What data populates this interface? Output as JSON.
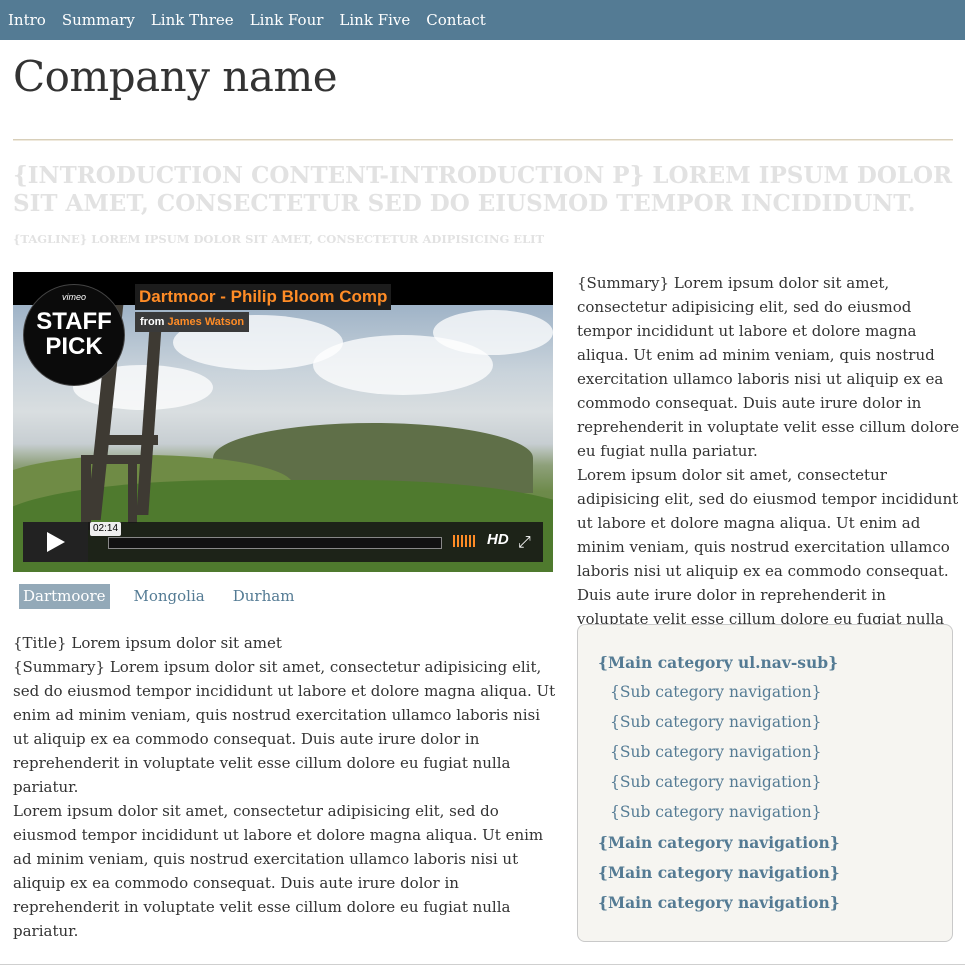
{
  "topnav": {
    "items": [
      "Intro",
      "Summary",
      "Link Three",
      "Link Four",
      "Link Five",
      "Contact"
    ]
  },
  "header": {
    "company_name": "Company name",
    "introduction": "{INTRODUCTION CONTENT-INTRODUCTION P} LOREM IPSUM DOLOR SIT AMET, CONSECTETUR SED DO EIUSMOD TEMPOR INCIDIDUNT.",
    "tagline": "{TAGLINE} LOREM IPSUM DOLOR SIT AMET, CONSECTETUR ADIPISICING ELIT"
  },
  "video": {
    "title": "Dartmoor - Philip Bloom Comp",
    "from_label": "from",
    "author": "James Watson",
    "badge_brand": "vimeo",
    "badge_text_1": "STAFF",
    "badge_text_2": "PICK",
    "time": "02:14",
    "hd_label": "HD",
    "play_icon": "play-icon",
    "fullscreen_icon": "fullscreen-icon",
    "volume_icon": "volume-icon",
    "colors": {
      "accent": "#ff8c26"
    }
  },
  "video_tabs": [
    {
      "label": "Dartmoore",
      "active": true
    },
    {
      "label": "Mongolia",
      "active": false
    },
    {
      "label": "Durham",
      "active": false
    }
  ],
  "left_content": {
    "title": "{Title} Lorem ipsum dolor sit amet",
    "summary": "{Summary} Lorem ipsum dolor sit amet, consectetur adipisicing elit, sed do eiusmod tempor incididunt ut labore et dolore magna aliqua. Ut enim ad minim veniam, quis nostrud exercitation ullamco laboris nisi ut aliquip ex ea commodo consequat. Duis aute irure dolor in reprehenderit in voluptate velit esse cillum dolore eu fugiat nulla pariatur.",
    "body": "Lorem ipsum dolor sit amet, consectetur adipisicing elit, sed do eiusmod tempor incididunt ut labore et dolore magna aliqua. Ut enim ad minim veniam, quis nostrud exercitation ullamco laboris nisi ut aliquip ex ea commodo consequat. Duis aute irure dolor in reprehenderit in voluptate velit esse cillum dolore eu fugiat nulla pariatur."
  },
  "right_content": {
    "summary": "{Summary} Lorem ipsum dolor sit amet, consectetur adipisicing elit, sed do eiusmod tempor incididunt ut labore et dolore magna aliqua. Ut enim ad minim veniam, quis nostrud exercitation ullamco laboris nisi ut aliquip ex ea commodo consequat. Duis aute irure dolor in reprehenderit in voluptate velit esse cillum dolore eu fugiat nulla pariatur.",
    "body": "Lorem ipsum dolor sit amet, consectetur adipisicing elit, sed do eiusmod tempor incididunt ut labore et dolore magna aliqua. Ut enim ad minim veniam, quis nostrud exercitation ullamco laboris nisi ut aliquip ex ea commodo consequat. Duis aute irure dolor in reprehenderit in voluptate velit esse cillum dolore eu fugiat nulla pariatur."
  },
  "sidebar": {
    "main_sub": "{Main category ul.nav-sub}",
    "sub_items": [
      "{Sub category navigation}",
      "{Sub category navigation}",
      "{Sub category navigation}",
      "{Sub category navigation}",
      "{Sub category navigation}"
    ],
    "main_items": [
      "{Main category navigation}",
      "{Main category navigation}",
      "{Main category navigation}"
    ]
  },
  "colors": {
    "nav_bg": "#547b94",
    "link": "#547b94",
    "tab_active_bg": "#93a9b8",
    "muted_text": "#e2e2e2"
  }
}
